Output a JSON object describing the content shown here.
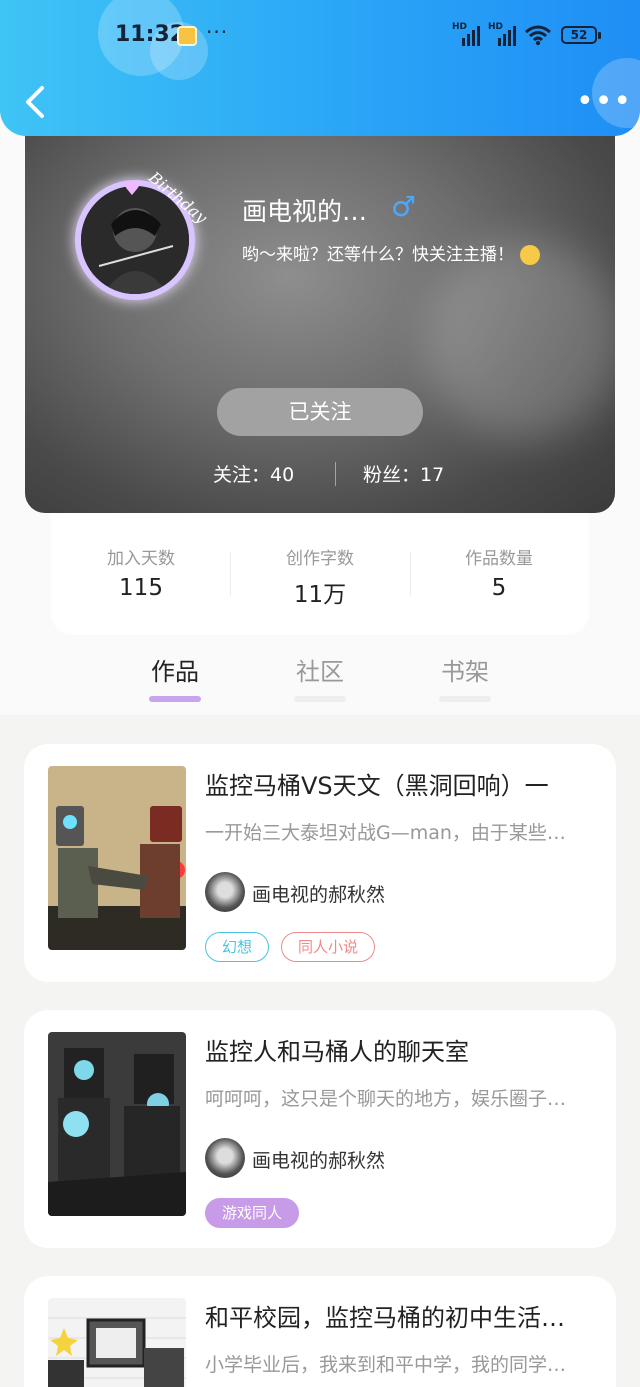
{
  "status_bar": {
    "time": "11:32",
    "signal1_label": "HD",
    "signal2_label": "HD",
    "battery": "52"
  },
  "header": {
    "back_icon": "chevron-left-icon",
    "more_icon": "more-dots-icon",
    "more_label": "•••"
  },
  "profile": {
    "avatar_decoration_text": "Birthday",
    "name": "画电视的…",
    "gender_symbol": "♂",
    "bio": "哟～来啦？还等什么？快关注主播！",
    "follow_button": "已关注",
    "following_label": "关注：40",
    "fans_label": "粉丝：17"
  },
  "stats": [
    {
      "label": "加入天数",
      "value": "115"
    },
    {
      "label": "创作字数",
      "value": "11万"
    },
    {
      "label": "作品数量",
      "value": "5"
    }
  ],
  "tabs": [
    {
      "label": "作品",
      "active": true
    },
    {
      "label": "社区",
      "active": false
    },
    {
      "label": "书架",
      "active": false
    }
  ],
  "works": [
    {
      "title": "监控马桶VS天文（黑洞回响）一",
      "desc": "一开始三大泰坦对战G—man，由于某些…",
      "author": "画电视的郝秋然",
      "tags": [
        {
          "label": "幻想",
          "color": "#4cc3e0",
          "filled": false
        },
        {
          "label": "同人小说",
          "color": "#f08a8a",
          "filled": false
        }
      ]
    },
    {
      "title": "监控人和马桶人的聊天室",
      "desc": "呵呵呵，这只是个聊天的地方，娱乐圈子…",
      "author": "画电视的郝秋然",
      "tags": [
        {
          "label": "游戏同人",
          "color": "#c79be8",
          "filled": true
        }
      ]
    },
    {
      "title": "和平校园，监控马桶的初中生活…",
      "desc": "小学毕业后，我来到和平中学，我的同学…",
      "author": "",
      "tags": []
    }
  ]
}
